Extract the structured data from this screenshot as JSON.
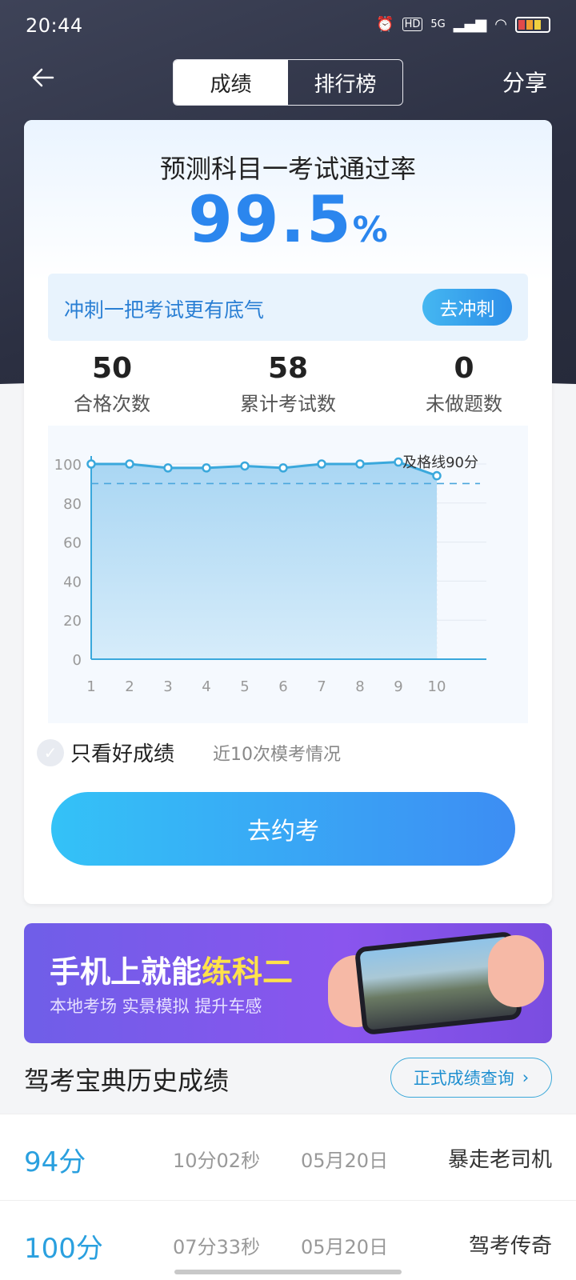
{
  "status_bar": {
    "time": "20:44",
    "network": "5G"
  },
  "header": {
    "tabs": [
      {
        "label": "成绩",
        "active": true
      },
      {
        "label": "排行榜",
        "active": false
      }
    ],
    "share_label": "分享"
  },
  "prediction": {
    "title": "预测科目一考试通过率",
    "rate_value": "99.5",
    "rate_unit": "%"
  },
  "sprint": {
    "text": "冲刺一把考试更有底气",
    "button_label": "去冲刺"
  },
  "stats": [
    {
      "value": "50",
      "label": "合格次数"
    },
    {
      "value": "58",
      "label": "累计考试数"
    },
    {
      "value": "0",
      "label": "未做题数"
    }
  ],
  "chart_data": {
    "type": "area",
    "x": [
      1,
      2,
      3,
      4,
      5,
      6,
      7,
      8,
      9,
      10
    ],
    "series": [
      {
        "values": [
          100,
          100,
          98,
          98,
          99,
          98,
          100,
          100,
          101,
          94
        ]
      }
    ],
    "ylim": [
      0,
      100
    ],
    "yticks": [
      0,
      20,
      40,
      60,
      80,
      100
    ],
    "reference_line": {
      "value": 90,
      "label": "及格线90分"
    },
    "grid": true,
    "colors": {
      "line": "#3aa8dc",
      "fill": "#bfe0f5",
      "reference": "#4aa6dc"
    }
  },
  "filter": {
    "label": "只看好成绩",
    "checked": false,
    "caption": "近10次模考情况"
  },
  "book_button": {
    "label": "去约考"
  },
  "banner": {
    "title_main": "手机上就能",
    "title_highlight": "练科二",
    "subtitle": "本地考场 实景模拟 提升车感"
  },
  "history": {
    "title": "驾考宝典历史成绩",
    "query_label": "正式成绩查询",
    "rows": [
      {
        "score": "94分",
        "duration": "10分02秒",
        "date": "05月20日",
        "title": "暴走老司机"
      },
      {
        "score": "100分",
        "duration": "07分33秒",
        "date": "05月20日",
        "title": "驾考传奇"
      }
    ]
  }
}
